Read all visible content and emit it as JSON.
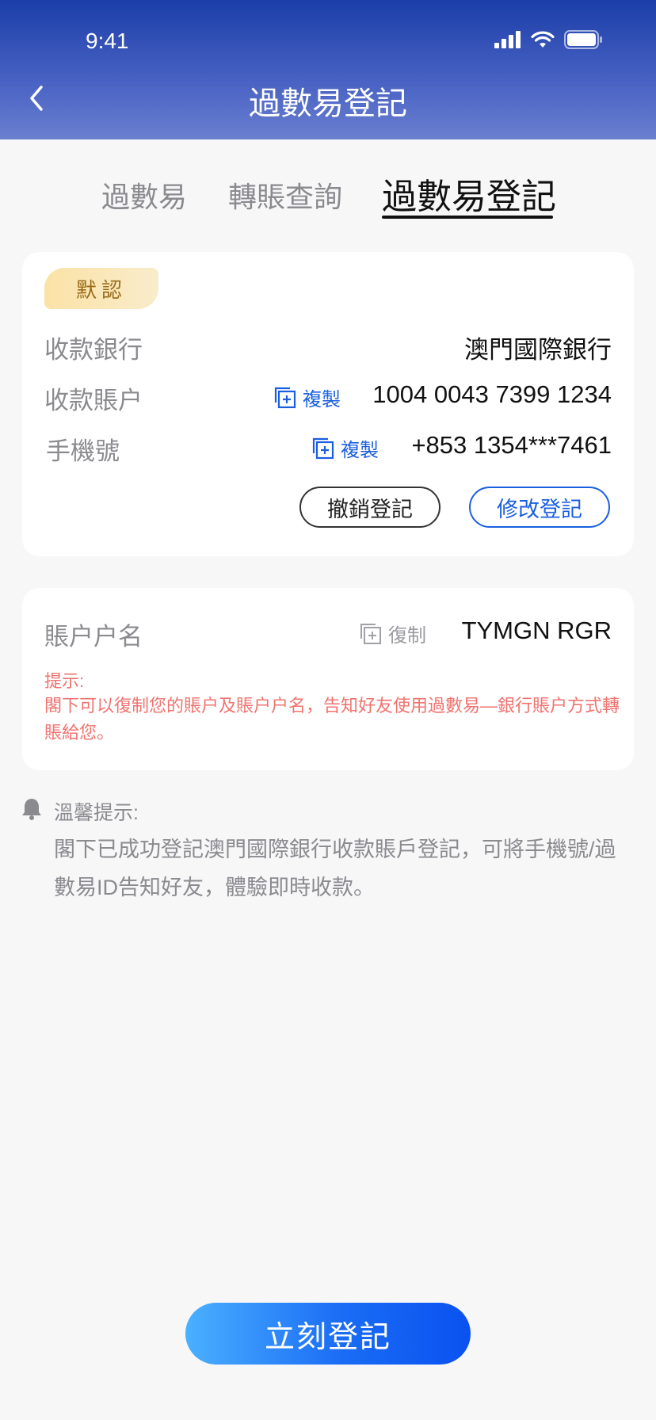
{
  "status_bar": {
    "time": "9:41"
  },
  "header": {
    "title": "過數易登記"
  },
  "tabs": [
    {
      "label": "過數易"
    },
    {
      "label": "轉賬查詢"
    },
    {
      "label": "過數易登記"
    }
  ],
  "account_card": {
    "badge": "默認",
    "bank": {
      "label": "收款銀行",
      "value": "澳門國際銀行"
    },
    "account": {
      "label": "收款賬户",
      "copy_label": "複製",
      "value": "1004 0043 7399 1234"
    },
    "phone": {
      "label": "手機號",
      "copy_label": "複製",
      "value": "+853 1354***7461"
    },
    "revoke_button": "撤銷登記",
    "modify_button": "修改登記"
  },
  "name_card": {
    "label": "賬户户名",
    "copy_label": "復制",
    "value": "TYMGN RGR",
    "tip_title": "提示:",
    "tip_text": "閣下可以復制您的賬户及賬户户名，告知好友使用過數易—銀行賬户方式轉賬給您。"
  },
  "notice": {
    "title": "溫馨提示:",
    "text": "閣下已成功登記澳門國際銀行收款賬戶登記，可將手機號/過數易ID告知好友，體驗即時收款。"
  },
  "cta_button": "立刻登記",
  "colors": {
    "accent": "#1a5fe0",
    "header": "#2a48b4",
    "warning": "#f0736f",
    "badge": "#fbe2a6"
  }
}
